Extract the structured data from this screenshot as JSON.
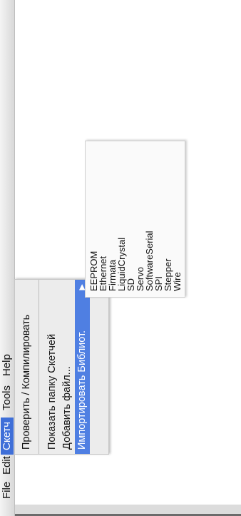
{
  "menubar": {
    "items": [
      "File",
      "Edit",
      "Скетч",
      "Tools",
      "Help"
    ]
  },
  "sketch_menu": {
    "items": [
      "Проверить / Компилировать",
      "Показать папку Скетчей",
      "Добавить файл...",
      "Импортировать Библиот."
    ]
  },
  "library_submenu": {
    "items": [
      "EEPROM",
      "Ethernet",
      "Firmata",
      "LiquidCrystal",
      "SD",
      "Servo",
      "SoftwareSerial",
      "SPI",
      "Stepper",
      "Wire"
    ]
  },
  "icons": {
    "submenu_arrow": "triangle-right-icon"
  },
  "colors": {
    "menu_highlight": "#4f7fe2",
    "menubar_active": "#3f6fd8"
  }
}
